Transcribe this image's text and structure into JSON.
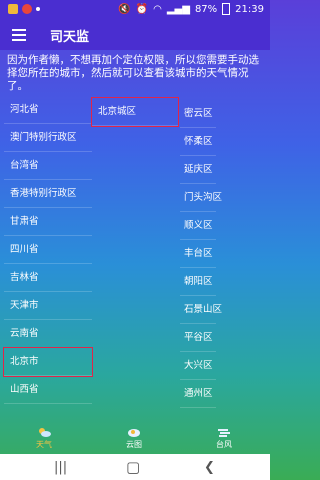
{
  "status": {
    "time": "21:39",
    "battery": "87%",
    "icons": [
      "gallery-icon",
      "shield-icon",
      "dot-icon",
      "mute-icon",
      "alarm-icon",
      "wifi-icon",
      "signal-icon",
      "battery-icon"
    ]
  },
  "appbar": {
    "title": "司天监",
    "menu_icon": "menu-icon"
  },
  "intro": "因为作者懒，不想再加个定位权限，所以您需要手动选择您所在的城市，然后就可以查看该城市的天气情况了。",
  "provinces": [
    "河北省",
    "澳门特别行政区",
    "台湾省",
    "香港特别行政区",
    "甘肃省",
    "四川省",
    "吉林省",
    "天津市",
    "云南省",
    "北京市",
    "山西省"
  ],
  "selected_province": "北京市",
  "city": {
    "label": "北京城区",
    "selected": true
  },
  "districts": [
    "密云区",
    "怀柔区",
    "延庆区",
    "门头沟区",
    "顺义区",
    "丰台区",
    "朝阳区",
    "石景山区",
    "平谷区",
    "大兴区",
    "通州区"
  ],
  "bottom_tabs": [
    {
      "label": "天气",
      "icon": "sun-cloud-icon",
      "active": true
    },
    {
      "label": "云图",
      "icon": "cloud-image-icon",
      "active": false
    },
    {
      "label": "台风",
      "icon": "typhoon-icon",
      "active": false
    }
  ],
  "colors": {
    "appbar": "#4a2ed0",
    "selection": "#e0254a",
    "active_tab": "#f5c343"
  }
}
